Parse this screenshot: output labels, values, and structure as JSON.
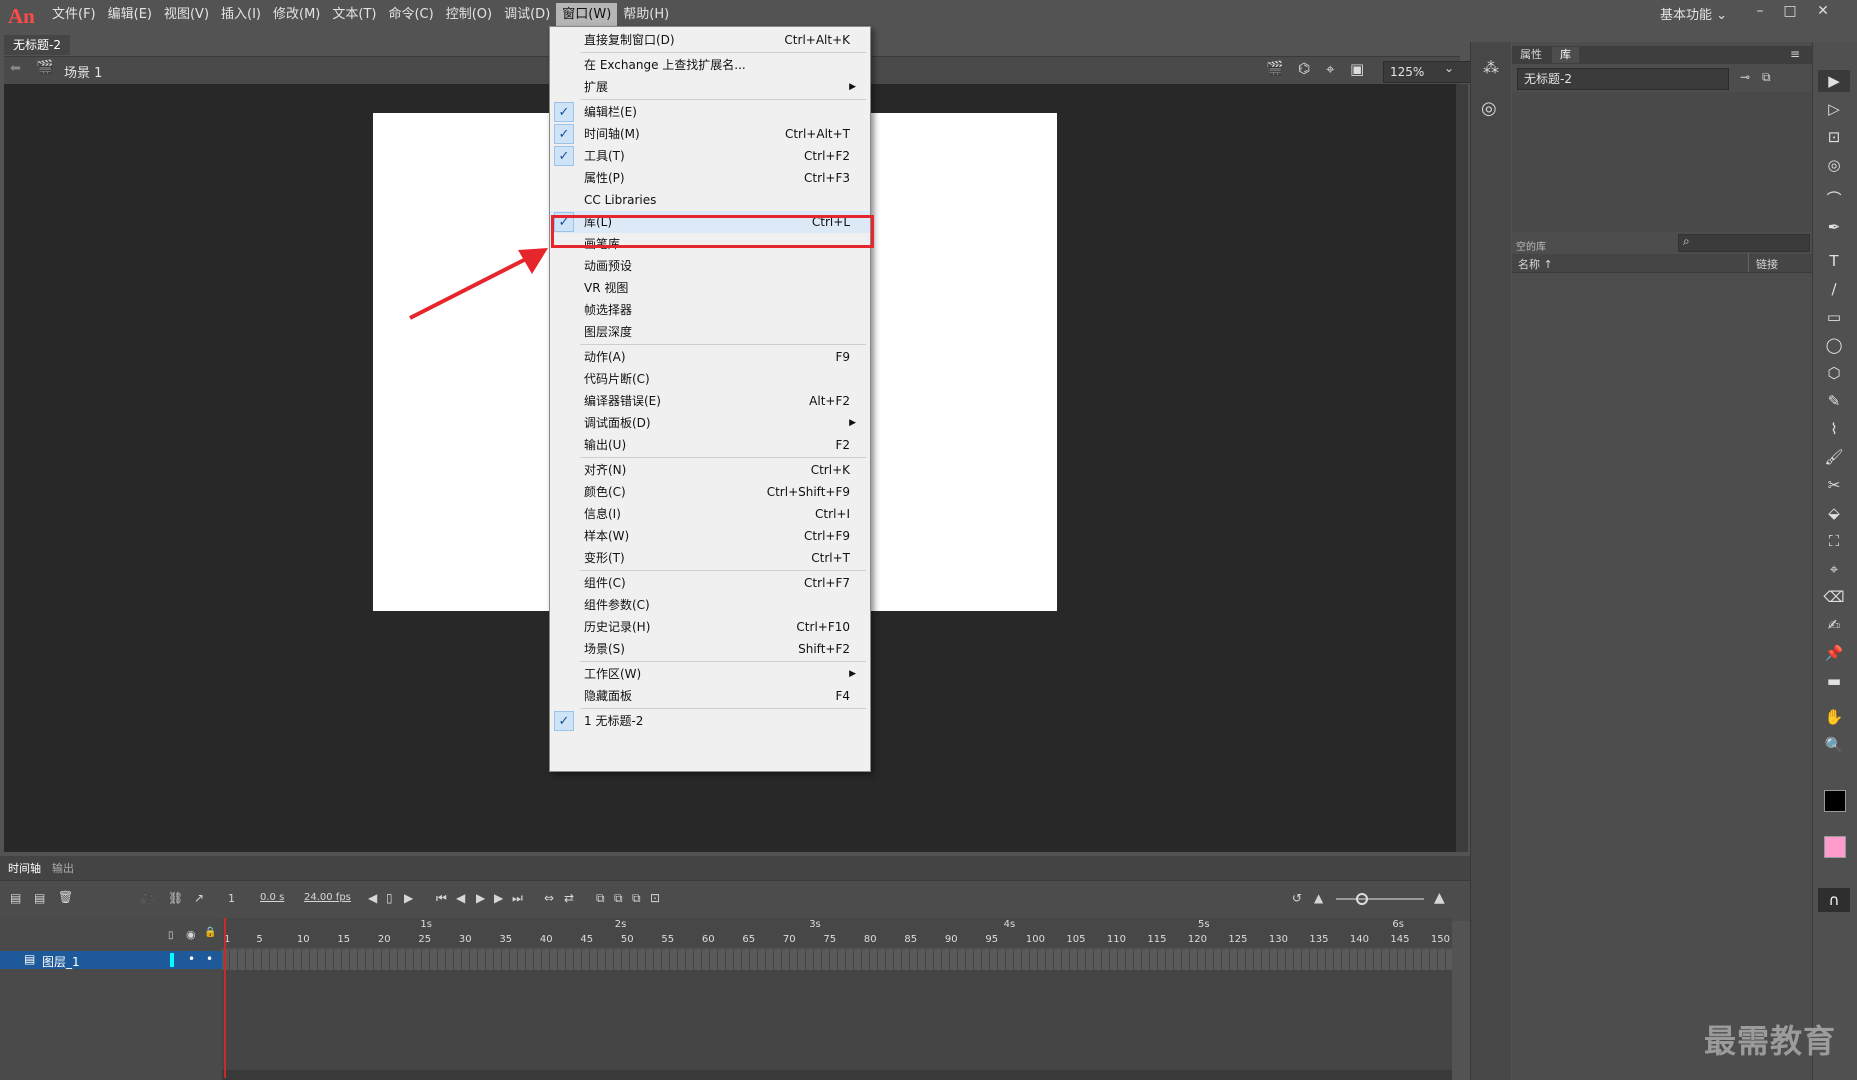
{
  "app": {
    "logo": "An"
  },
  "menubar": [
    "文件(F)",
    "编辑(E)",
    "视图(V)",
    "插入(I)",
    "修改(M)",
    "文本(T)",
    "命令(C)",
    "控制(O)",
    "调试(D)",
    "窗口(W)",
    "帮助(H)"
  ],
  "workspace": "基本功能",
  "document": {
    "tab": "无标题-2",
    "scene": "场景 1",
    "zoom": "125%"
  },
  "timeline": {
    "tabs": [
      "时间轴",
      "输出"
    ],
    "current_frame": "1",
    "time": "0.0 s",
    "fps": "24.00 fps",
    "seconds": [
      "1s",
      "2s",
      "3s",
      "4s",
      "5s",
      "6s"
    ],
    "frame_ticks": [
      "1",
      "5",
      "10",
      "15",
      "20",
      "25",
      "30",
      "35",
      "40",
      "45",
      "50",
      "55",
      "60",
      "65",
      "70",
      "75",
      "80",
      "85",
      "90",
      "95",
      "100",
      "105",
      "110",
      "115",
      "120",
      "125",
      "130",
      "135",
      "140",
      "145",
      "150"
    ],
    "layer_name": "图层_1"
  },
  "panels": {
    "tabs": [
      "属性",
      "库"
    ],
    "library_doc": "无标题-2",
    "empty_label": "空的库",
    "col_name": "名称 ↑",
    "col_link": "链接"
  },
  "window_menu": [
    {
      "label": "直接复制窗口(D)",
      "shortcut": "Ctrl+Alt+K",
      "checked": false
    },
    {
      "label": "在 Exchange 上查找扩展名...",
      "shortcut": "",
      "checked": false,
      "sep_before": true
    },
    {
      "label": "扩展",
      "shortcut": "",
      "checked": false,
      "submenu": true
    },
    {
      "label": "编辑栏(E)",
      "shortcut": "",
      "checked": true,
      "sep_before": true
    },
    {
      "label": "时间轴(M)",
      "shortcut": "Ctrl+Alt+T",
      "checked": true
    },
    {
      "label": "工具(T)",
      "shortcut": "Ctrl+F2",
      "checked": true
    },
    {
      "label": "属性(P)",
      "shortcut": "Ctrl+F3",
      "checked": false
    },
    {
      "label": "CC Libraries",
      "shortcut": "",
      "checked": false
    },
    {
      "label": "库(L)",
      "shortcut": "Ctrl+L",
      "checked": true,
      "highlighted": true
    },
    {
      "label": "画笔库",
      "shortcut": "",
      "checked": false
    },
    {
      "label": "动画预设",
      "shortcut": "",
      "checked": false
    },
    {
      "label": "VR 视图",
      "shortcut": "",
      "checked": false
    },
    {
      "label": "帧选择器",
      "shortcut": "",
      "checked": false
    },
    {
      "label": "图层深度",
      "shortcut": "",
      "checked": false
    },
    {
      "label": "动作(A)",
      "shortcut": "F9",
      "checked": false,
      "sep_before": true
    },
    {
      "label": "代码片断(C)",
      "shortcut": "",
      "checked": false
    },
    {
      "label": "编译器错误(E)",
      "shortcut": "Alt+F2",
      "checked": false
    },
    {
      "label": "调试面板(D)",
      "shortcut": "",
      "checked": false,
      "submenu": true
    },
    {
      "label": "输出(U)",
      "shortcut": "F2",
      "checked": false
    },
    {
      "label": "对齐(N)",
      "shortcut": "Ctrl+K",
      "checked": false,
      "sep_before": true
    },
    {
      "label": "颜色(C)",
      "shortcut": "Ctrl+Shift+F9",
      "checked": false
    },
    {
      "label": "信息(I)",
      "shortcut": "Ctrl+I",
      "checked": false
    },
    {
      "label": "样本(W)",
      "shortcut": "Ctrl+F9",
      "checked": false
    },
    {
      "label": "变形(T)",
      "shortcut": "Ctrl+T",
      "checked": false
    },
    {
      "label": "组件(C)",
      "shortcut": "Ctrl+F7",
      "checked": false,
      "sep_before": true
    },
    {
      "label": "组件参数(C)",
      "shortcut": "",
      "checked": false
    },
    {
      "label": "历史记录(H)",
      "shortcut": "Ctrl+F10",
      "checked": false
    },
    {
      "label": "场景(S)",
      "shortcut": "Shift+F2",
      "checked": false
    },
    {
      "label": "工作区(W)",
      "shortcut": "",
      "checked": false,
      "submenu": true,
      "sep_before": true
    },
    {
      "label": "隐藏面板",
      "shortcut": "F4",
      "checked": false
    },
    {
      "label": "1 无标题-2",
      "shortcut": "",
      "checked": true,
      "sep_before": true
    }
  ],
  "icons": {
    "check": "✓",
    "submenu_arrow": "▶",
    "dropdown": "⌄",
    "minimize": "–",
    "maximize": "□",
    "close": "✕",
    "eye": "◉",
    "lock": "🔒",
    "play": "▶",
    "step_back": "◀",
    "step_fwd": "▶",
    "first": "⏮",
    "last": "⏭",
    "search": "⌕",
    "trash": "🗑",
    "folder": "▤"
  },
  "tools": [
    "▶",
    "▷",
    "⊡",
    "◎",
    "⌒",
    "✒",
    "T",
    "∕",
    "▭",
    "◯",
    "⬡",
    "✎",
    "⌇",
    "🖌",
    "✂",
    "⬙",
    "⛶",
    "⌖",
    "⌫",
    "✍",
    "📌",
    "▬",
    "✋",
    "🔍"
  ],
  "watermark": "最需教育",
  "colors": {
    "accent_red": "#e6262d",
    "check_bg": "#cfe3f7",
    "layer_sel": "#1e5a99"
  }
}
